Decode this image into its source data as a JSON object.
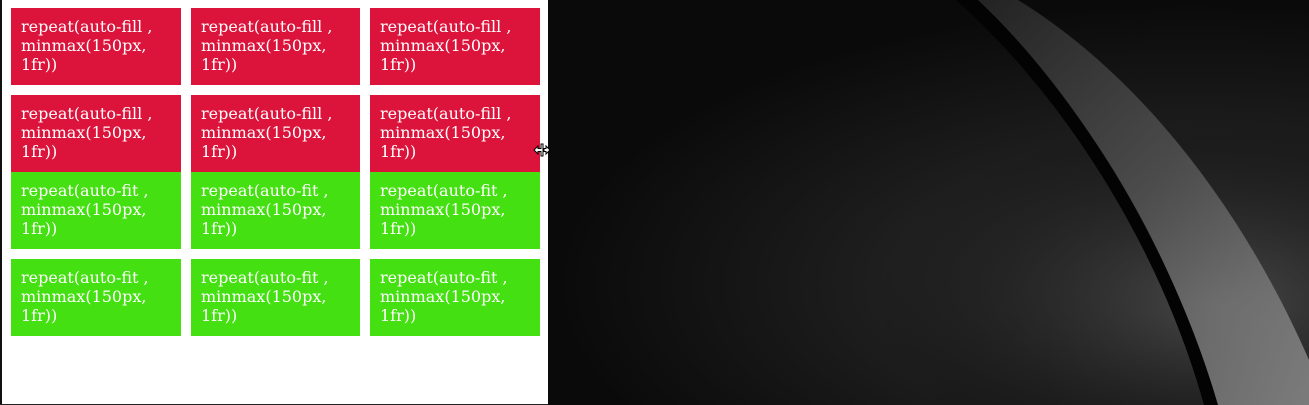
{
  "auto_fill_grid": {
    "cells": [
      "repeat(auto-fill , minmax(150px, 1fr))",
      "repeat(auto-fill , minmax(150px, 1fr))",
      "repeat(auto-fill , minmax(150px, 1fr))",
      "repeat(auto-fill , minmax(150px, 1fr))",
      "repeat(auto-fill , minmax(150px, 1fr))",
      "repeat(auto-fill , minmax(150px, 1fr))"
    ],
    "color": "#dc143c"
  },
  "auto_fit_grid": {
    "cells": [
      "repeat(auto-fit , minmax(150px, 1fr))",
      "repeat(auto-fit , minmax(150px, 1fr))",
      "repeat(auto-fit , minmax(150px, 1fr))",
      "repeat(auto-fit , minmax(150px, 1fr))",
      "repeat(auto-fit , minmax(150px, 1fr))",
      "repeat(auto-fit , minmax(150px, 1fr))"
    ],
    "color": "#44e011"
  },
  "cursor": {
    "icon": "horizontal-resize-cursor-icon"
  },
  "wallpaper": {
    "icon": "abstract-curve-wallpaper"
  }
}
